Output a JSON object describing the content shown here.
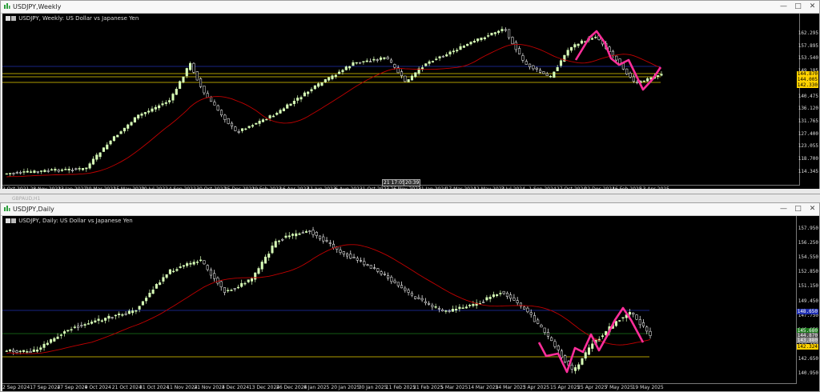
{
  "weekly": {
    "title": "USDJPY,Weekly",
    "header": "USDJPY, Weekly:  US Dollar vs Japanese Yen",
    "price_ticks": [
      "162.295",
      "157.895",
      "153.540",
      "149.185",
      "144.830",
      "140.475",
      "136.120",
      "131.765",
      "127.400",
      "123.055",
      "118.700",
      "114.345"
    ],
    "price_tags": [
      {
        "text": "144.870",
        "bg": "#ffd200",
        "fg": "#000"
      },
      {
        "text": "144.005",
        "bg": "#ffd200",
        "fg": "#000"
      },
      {
        "text": "142.330",
        "bg": "#ffd200",
        "fg": "#000"
      }
    ],
    "time_labels": [
      "3 Oct 2021",
      "28 Nov 2021",
      "23 Jan 2022",
      "20 Mar 2022",
      "15 May 2022",
      "10 Jul 2022",
      "4 Sep 2022",
      "30 Oct 2022",
      "25 Dec 2022",
      "19 Feb 2023",
      "16 Apr 2023",
      "11 Jun 2023",
      "6 Aug 2023",
      "1 Oct 2023",
      "26 Nov 2023",
      "21 Jan 2024",
      "17 Mar 2024",
      "12 May 2024",
      "7 Jul 2024",
      "1 Sep 2024",
      "27 Oct 2024",
      "22 Dec 2024",
      "16 Feb 2025",
      "13 Apr 2025"
    ],
    "crosshair_labels": [
      "21 17:05",
      "20:39"
    ]
  },
  "hidden_window": {
    "title": "GBPAUD,H1"
  },
  "daily": {
    "title": "USDJPY,Daily",
    "header": "USDJPY, Daily:  US Dollar vs Japanese Yen",
    "price_ticks": [
      "157.950",
      "156.250",
      "154.550",
      "152.850",
      "151.150",
      "149.450",
      "147.750",
      "146.050",
      "144.350",
      "142.650",
      "140.950"
    ],
    "price_tags": [
      {
        "text": "148.650",
        "bg": "#1f2fb0",
        "fg": "#fff"
      },
      {
        "text": "145.680",
        "bg": "#1c7a1c",
        "fg": "#fff"
      },
      {
        "text": "144.870",
        "bg": "#555555",
        "fg": "#fff"
      },
      {
        "text": "143.880",
        "bg": "#888888",
        "fg": "#fff"
      },
      {
        "text": "142.324",
        "bg": "#ffd200",
        "fg": "#000"
      }
    ],
    "time_labels": [
      "2 Sep 2024",
      "17 Sep 2024",
      "27 Sep 2024",
      "9 Oct 2024",
      "21 Oct 2024",
      "31 Oct 2024",
      "11 Nov 2024",
      "21 Nov 2024",
      "3 Dec 2024",
      "13 Dec 2024",
      "26 Dec 2024",
      "8 Jan 2025",
      "20 Jan 2025",
      "30 Jan 2025",
      "11 Feb 2025",
      "21 Feb 2025",
      "5 Mar 2025",
      "14 Mar 2025",
      "24 Mar 2025",
      "3 Apr 2025",
      "15 Apr 2025",
      "25 Apr 2025",
      "7 May 2025",
      "19 May 2025"
    ]
  },
  "colors": {
    "bull": "#d8ffb8",
    "bear": "#ffffff",
    "ma": "#c00000",
    "pink": "#ff2e9a",
    "blue_line": "#1f2fb0",
    "yellow": "#e8d200",
    "green_line": "#1c7a1c"
  },
  "window_buttons": {
    "minimize": "—",
    "maximize": "□",
    "close": "✕"
  }
}
